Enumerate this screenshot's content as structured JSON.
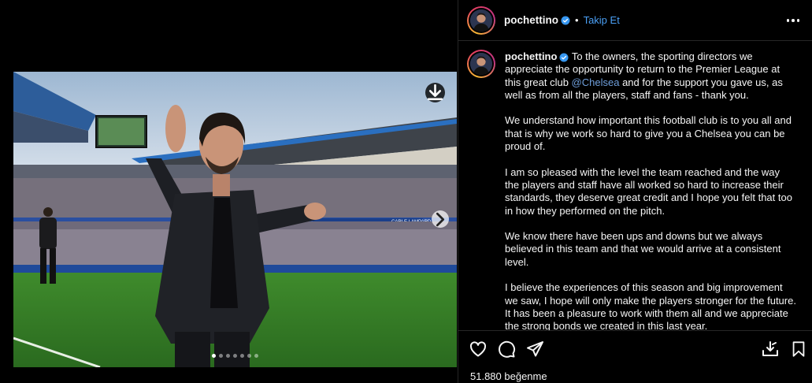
{
  "post": {
    "username": "pochettino",
    "follow_label": "Takip Et",
    "separator": "•",
    "caption_intro": "To the owners, the sporting directors we appreciate the opportunity to return to the Premier League at this great club ",
    "mention": "@Chelsea",
    "caption_intro_rest": " and for the support you gave us, as well as from all the players, staff and fans - thank you.",
    "paragraphs": [
      "We understand how important this football club is to you all and that is why we work so hard to give you a Chelsea you can be proud of.",
      "I am so pleased with the level the team reached and the way the players and staff have all worked so hard to increase their standards, they deserve great credit and I hope you felt that too in how they performed on the pitch.",
      "We know there have been ups and downs but we always believed in this team and that we would arrive at a consistent level.",
      "I believe the experiences of this season and big improvement we saw, I hope will only make the players stronger for the future. It has been a pleasure to work with them all and we appreciate the strong bonds we created in this last year."
    ],
    "likes_text": "51.880 beğenme"
  },
  "media": {
    "slide_count": 7,
    "active_slide": 0,
    "stadium_banner": "CARLE LAMPARD"
  },
  "icons": {
    "download": "download-icon",
    "next": "chevron-right-icon",
    "like": "heart-icon",
    "comment": "comment-icon",
    "share": "share-icon",
    "save_to_collection": "download-icon",
    "bookmark": "bookmark-icon",
    "more": "more-options-icon",
    "verified": "verified-badge-icon"
  },
  "colors": {
    "background": "#000000",
    "link": "#4a9ff5",
    "verified": "#3797f0",
    "border": "#262626"
  }
}
